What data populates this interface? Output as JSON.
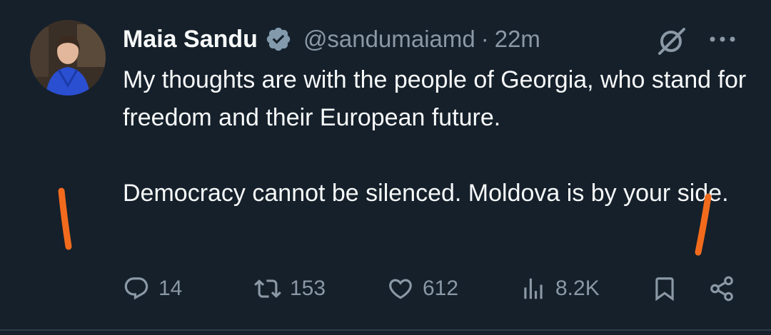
{
  "author": {
    "name": "Maia Sandu",
    "handle": "@sandumaiamd",
    "separator": "·",
    "time": "22m",
    "verified": true
  },
  "tweet": {
    "paragraph1": "My thoughts are with the people of Georgia, who stand for freedom and their European future.",
    "paragraph2": "Democracy cannot be silenced. Moldova is by your side."
  },
  "actions": {
    "replies": "14",
    "reposts": "153",
    "likes": "612",
    "views": "8.2K"
  },
  "icons": {
    "reply": "reply-icon",
    "repost": "repost-icon",
    "like": "heart-icon",
    "views": "views-icon",
    "bookmark": "bookmark-icon",
    "share": "share-icon",
    "grok": "grok-icon",
    "more": "more-icon",
    "verified": "verified-badge-icon"
  },
  "colors": {
    "background": "#15202b",
    "text": "#f7f9f9",
    "secondary": "#8b98a5",
    "verified": "#829aab",
    "annotation_marks": "#f26b1d"
  }
}
